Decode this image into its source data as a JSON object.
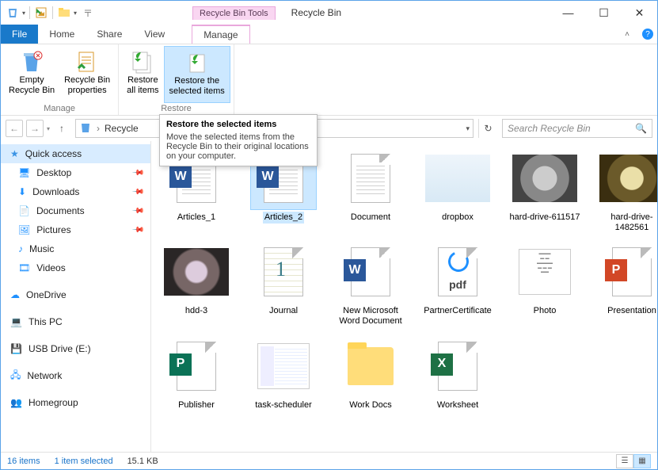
{
  "titlebar": {
    "tools_context": "Recycle Bin Tools",
    "title": "Recycle Bin"
  },
  "tabs": {
    "file": "File",
    "home": "Home",
    "share": "Share",
    "view": "View",
    "manage": "Manage"
  },
  "ribbon": {
    "empty": "Empty\nRecycle Bin",
    "properties": "Recycle Bin\nproperties",
    "restore_all": "Restore\nall items",
    "restore_selected": "Restore the\nselected items",
    "group_manage": "Manage",
    "group_restore": "Restore"
  },
  "address": {
    "crumb": "Recycle"
  },
  "search": {
    "placeholder": "Search Recycle Bin"
  },
  "sidebar": {
    "quick": "Quick access",
    "desktop": "Desktop",
    "downloads": "Downloads",
    "documents": "Documents",
    "pictures": "Pictures",
    "music": "Music",
    "videos": "Videos",
    "onedrive": "OneDrive",
    "thispc": "This PC",
    "usb": "USB Drive (E:)",
    "network": "Network",
    "homegroup": "Homegroup"
  },
  "tooltip": {
    "title": "Restore the selected items",
    "body": "Move the selected items from the Recycle Bin to their original locations on your computer."
  },
  "items": {
    "0": "Articles_1",
    "1": "Articles_2",
    "2": "Document",
    "3": "dropbox",
    "4": "hard-drive-611517",
    "5": "hard-drive-1482561",
    "6": "hdd-3",
    "7": "Journal",
    "8": "New Microsoft Word Document",
    "9": "PartnerCertificate",
    "10": "Photo",
    "11": "Presentation",
    "12": "Publisher",
    "13": "task-scheduler",
    "14": "Work Docs",
    "15": "Worksheet"
  },
  "status": {
    "count": "16 items",
    "selected": "1 item selected",
    "size": "15.1 KB"
  }
}
